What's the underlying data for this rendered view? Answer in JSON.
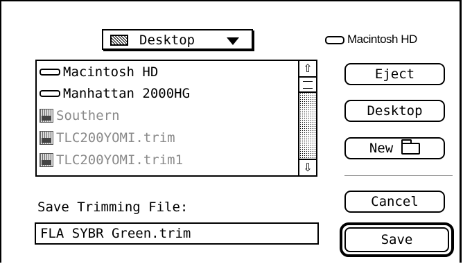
{
  "location_popup": {
    "label": "Desktop",
    "icon": "desktop-disk-icon"
  },
  "volume": {
    "label": "Macintosh HD",
    "icon": "hard-disk-icon"
  },
  "file_list": {
    "items": [
      {
        "label": "Macintosh HD",
        "icon": "hard-disk-icon",
        "enabled": true
      },
      {
        "label": "Manhattan 2000HG",
        "icon": "hard-disk-icon",
        "enabled": true
      },
      {
        "label": "Southern",
        "icon": "fuji-document-icon",
        "enabled": false
      },
      {
        "label": "TLC200YOMI.trim",
        "icon": "fuji-document-icon",
        "enabled": false
      },
      {
        "label": "TLC200YOMI.trim1",
        "icon": "fuji-document-icon",
        "enabled": false
      }
    ]
  },
  "buttons": {
    "eject": "Eject",
    "desktop": "Desktop",
    "new": "New",
    "cancel": "Cancel",
    "save": "Save"
  },
  "prompt": "Save Trimming File:",
  "filename": {
    "value": "FLA SYBR Green.trim"
  }
}
